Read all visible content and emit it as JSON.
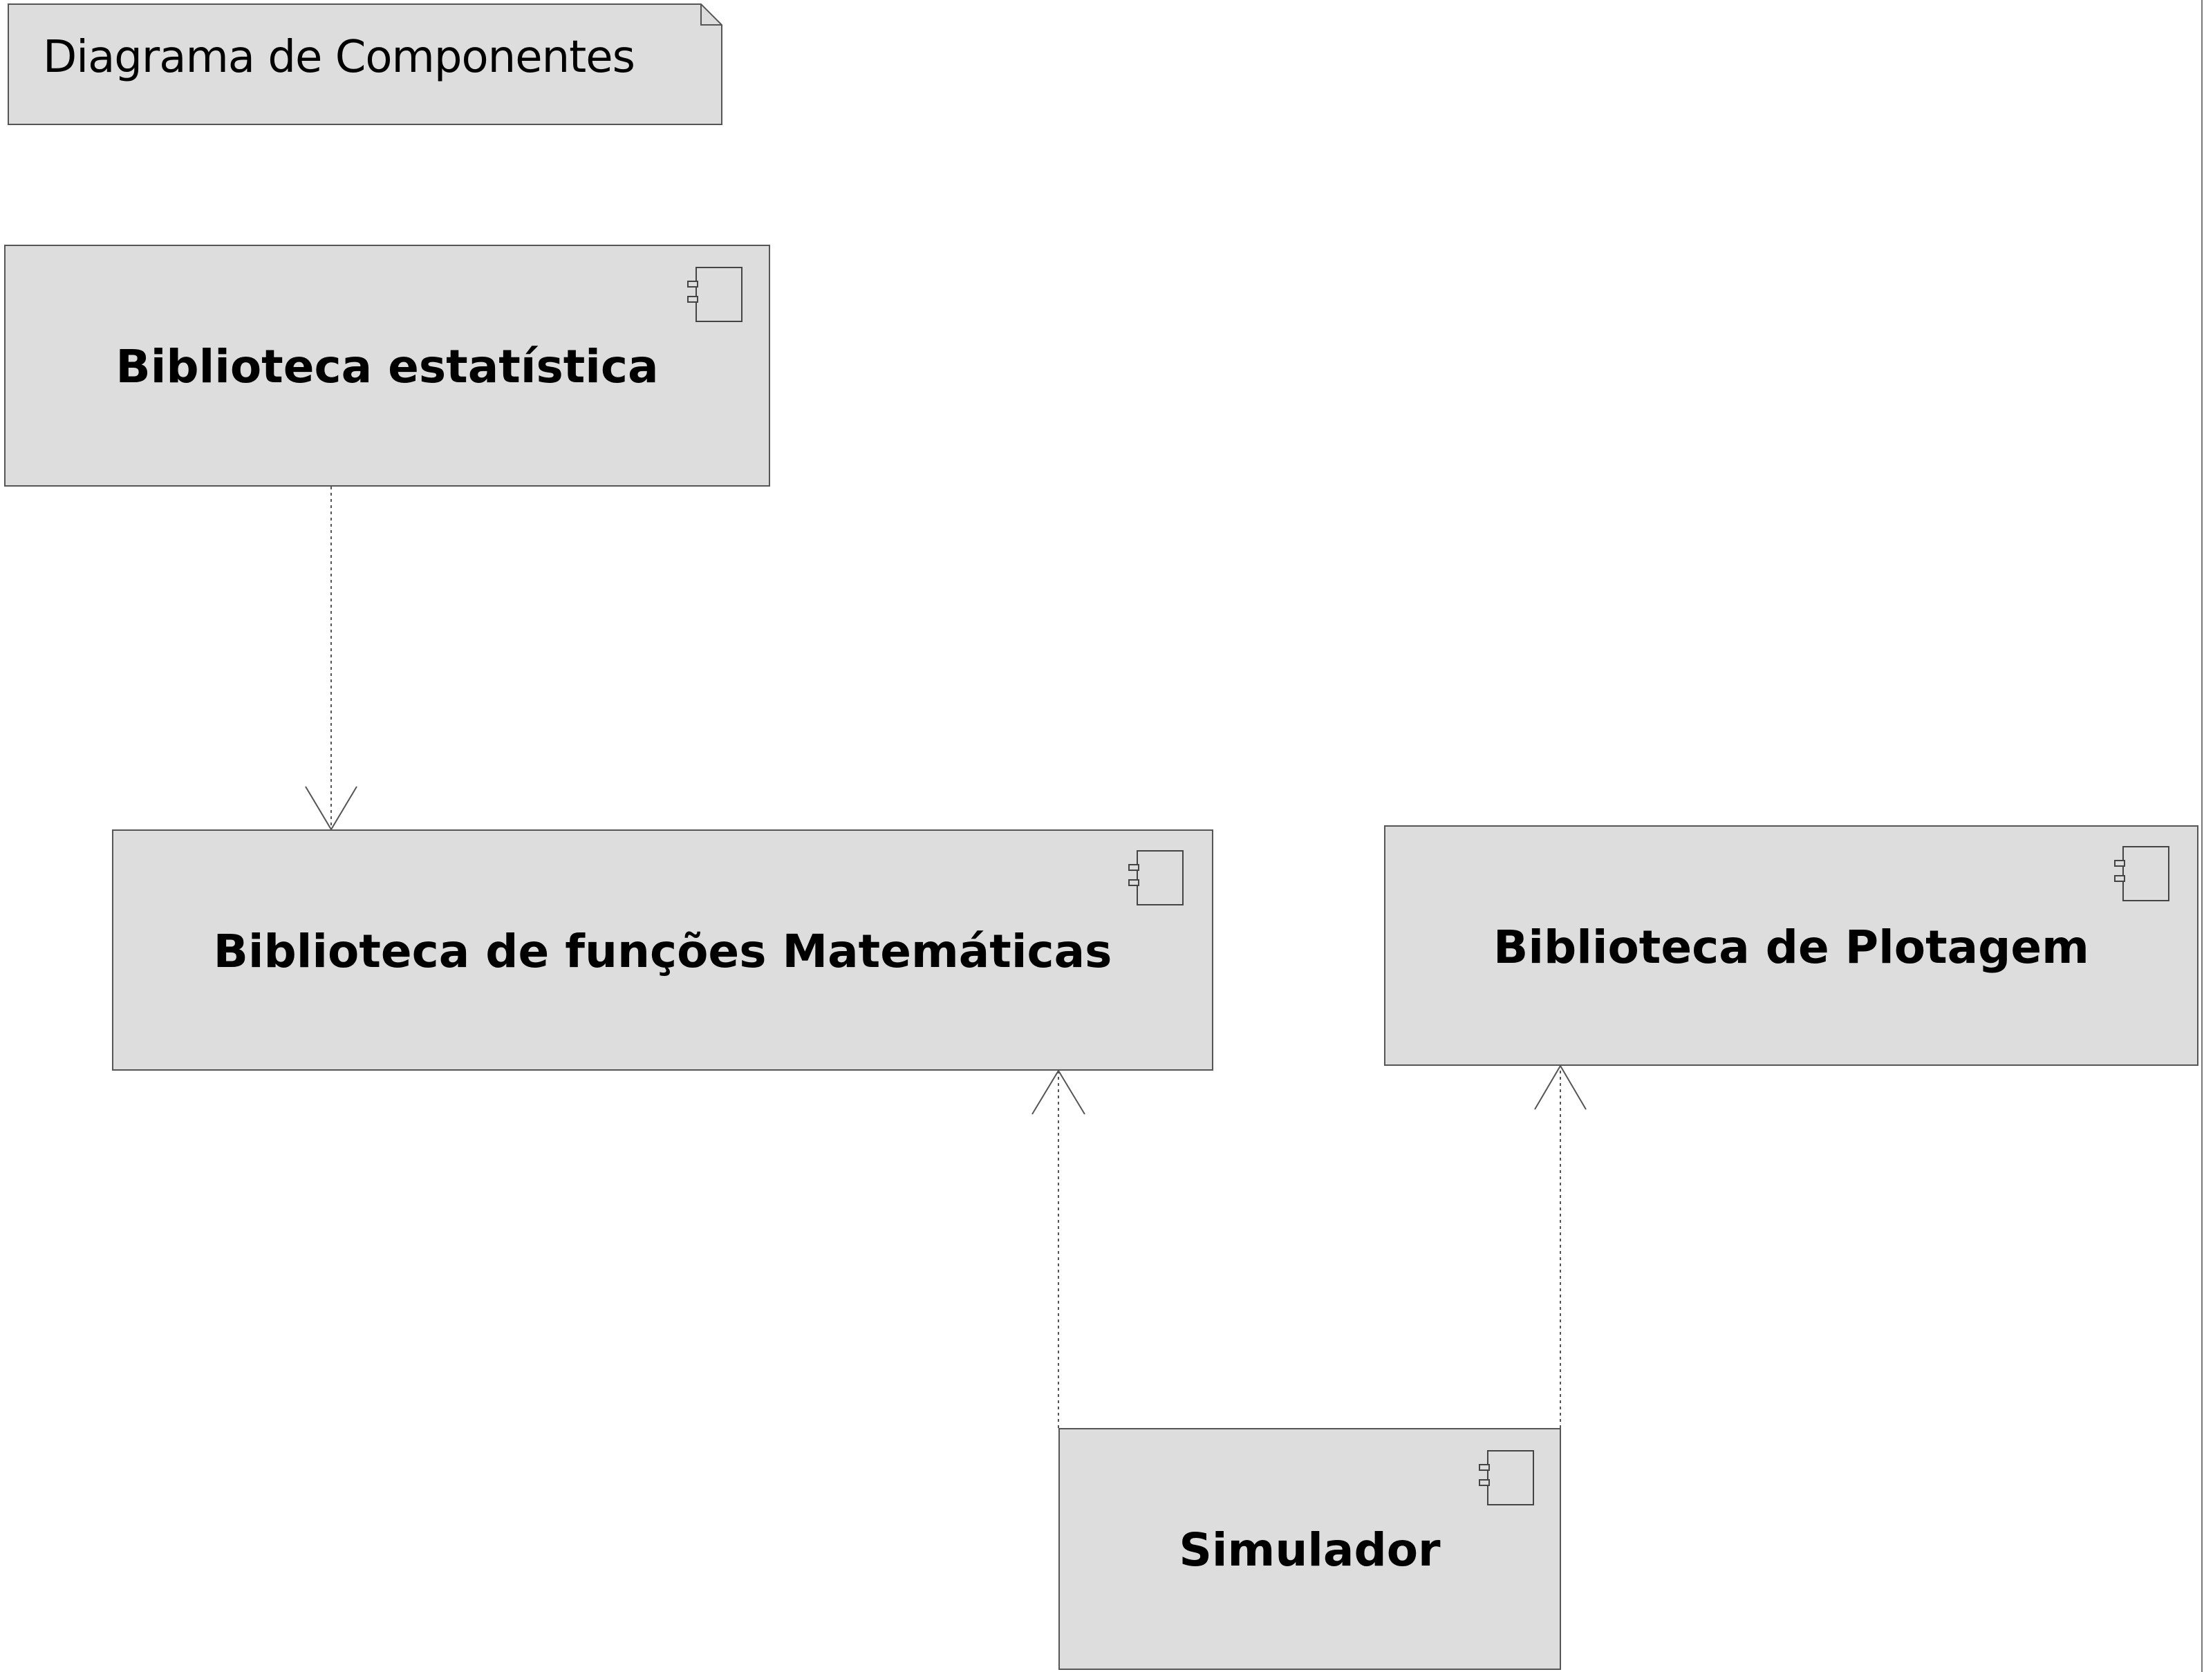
{
  "diagram": {
    "title": "Diagrama de Componentes",
    "components": [
      {
        "id": "estatistica",
        "name": "Biblioteca estatística",
        "icon": "component-icon"
      },
      {
        "id": "matematica",
        "name": "Biblioteca de funções Matemáticas",
        "icon": "component-icon"
      },
      {
        "id": "plotagem",
        "name": "Biblioteca de Plotagem",
        "icon": "component-icon"
      },
      {
        "id": "simulador",
        "name": "Simulador",
        "icon": "component-icon"
      }
    ],
    "dependencies": [
      {
        "from": "estatistica",
        "to": "matematica",
        "style": "dashed-open-arrow"
      },
      {
        "from": "simulador",
        "to": "matematica",
        "style": "dashed-open-arrow"
      },
      {
        "from": "simulador",
        "to": "plotagem",
        "style": "dashed-open-arrow"
      }
    ],
    "colors": {
      "component_fill": "#dddddd",
      "border": "#555555",
      "text": "#000000",
      "background": "#ffffff"
    }
  }
}
